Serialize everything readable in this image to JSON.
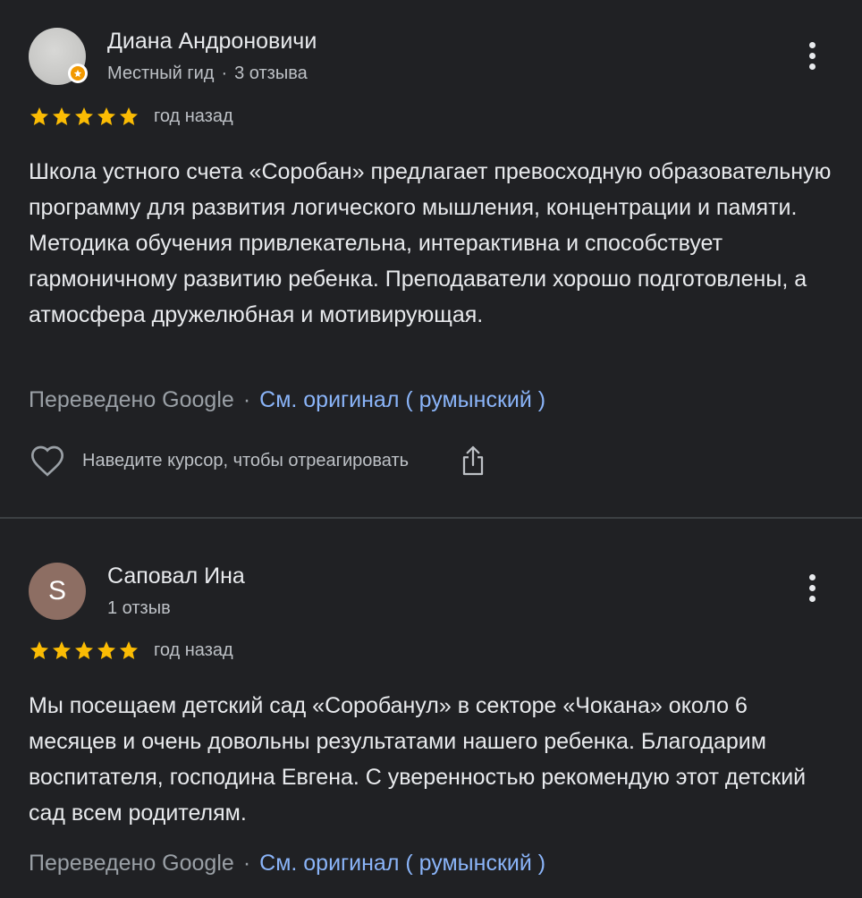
{
  "colors": {
    "background": "#202124",
    "divider": "#3c4043",
    "star": "#fbbc04",
    "link": "#8ab4f8",
    "avatar_letter_bg": "#8d6e63",
    "guide_badge": "#f29900"
  },
  "icons": {
    "more": "more-vert-icon",
    "star": "star-icon",
    "like": "heart-outline-icon",
    "share": "share-icon",
    "badge": "local-guide-badge-icon"
  },
  "reviews": [
    {
      "author": "Диана Андроновичи",
      "badge": "Местный гид",
      "review_count": "3 отзыва",
      "rating": 5,
      "date": "год назад",
      "text": "Школа устного счета «Соробан» предлагает превосходную образовательную программу для развития логического мышления, концентрации и памяти. Методика обучения привлекательна, интерактивна и способствует гармоничному развитию ребенка. Преподаватели хорошо подготовлены, а атмосфера дружелюбная и мотивирующая.",
      "translated_by": "Переведено Google",
      "original_link": "См. оригинал ( румынский )",
      "react_hint": "Наведите курсор, чтобы отреагировать"
    },
    {
      "author": "Саповал Ина",
      "avatar_letter": "S",
      "review_count": "1 отзыв",
      "rating": 5,
      "date": "год назад",
      "text": "Мы посещаем детский сад «Соробанул» в секторе «Чокана» около 6 месяцев и очень довольны результатами нашего ребенка. Благодарим воспитателя, господина Евгена. С уверенностью рекомендую этот детский сад всем родителям.",
      "translated_by": "Переведено Google",
      "original_link": "См. оригинал ( румынский )"
    }
  ]
}
